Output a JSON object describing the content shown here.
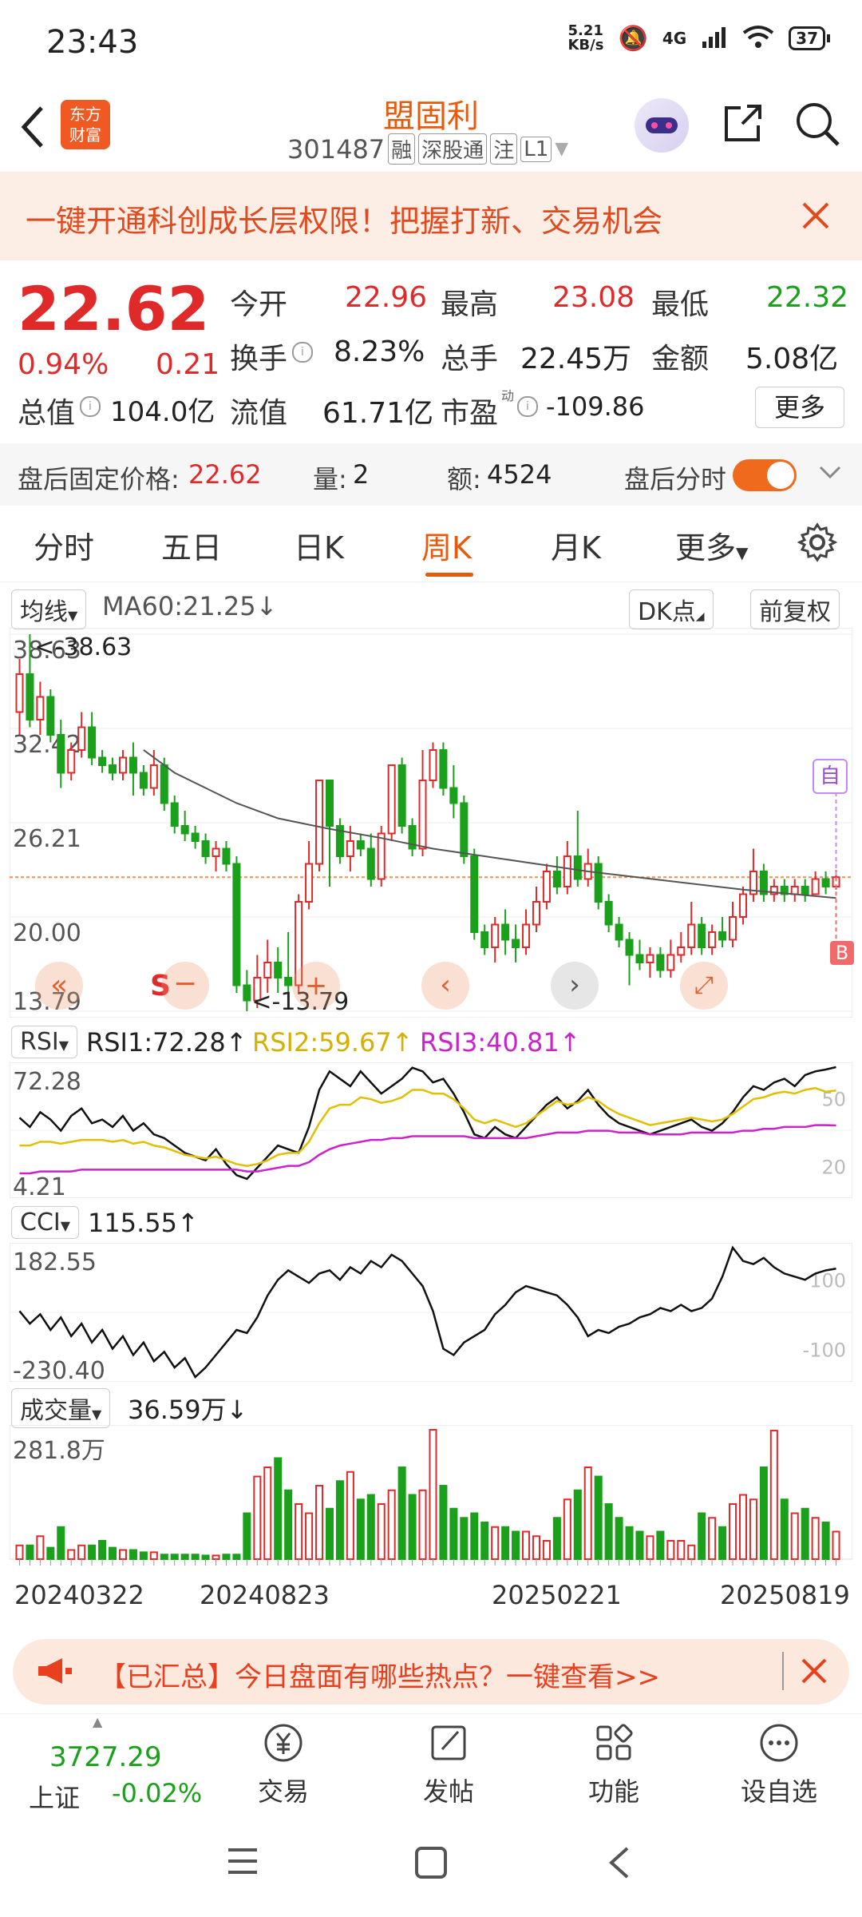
{
  "status": {
    "time": "23:43",
    "net_speed": "5.21",
    "net_unit": "KB/s",
    "network": "4G",
    "battery": "37"
  },
  "header": {
    "logo_line1": "东方",
    "logo_line2": "财富",
    "title": "盟固利",
    "code": "301487",
    "tags": [
      "融",
      "深股通",
      "注",
      "L1"
    ]
  },
  "banner": {
    "text": "一键开通科创成长层权限！把握打新、交易机会"
  },
  "quote": {
    "price": "22.62",
    "change_pct": "0.94%",
    "change": "0.21",
    "open_label": "今开",
    "open": "22.96",
    "high_label": "最高",
    "high": "23.08",
    "low_label": "最低",
    "low": "22.32",
    "turnover_label": "换手",
    "turnover": "8.23%",
    "volume_label": "总手",
    "volume": "22.45万",
    "amount_label": "金额",
    "amount": "5.08亿",
    "mktcap_label": "总值",
    "mktcap": "104.0亿",
    "float_label": "流值",
    "float": "61.71亿",
    "pe_label": "市盈",
    "pe_sup": "动",
    "pe": "-109.86",
    "more": "更多"
  },
  "afterhours": {
    "label": "盘后固定价格:",
    "price": "22.62",
    "vol_label": "量:",
    "vol": "2",
    "amt_label": "额:",
    "amt": "4524",
    "switch_label": "盘后分时"
  },
  "tabs": [
    "分时",
    "五日",
    "日K",
    "周K",
    "月K",
    "更多"
  ],
  "chart_controls": {
    "ma_select": "均线",
    "ma_text": "MA60:21.25",
    "dk": "DK点",
    "adjust": "前复权"
  },
  "chart_data": [
    {
      "type": "candlestick",
      "name": "周K",
      "y_labels": [
        "38.63",
        "32.42",
        "26.21",
        "20.00",
        "13.79"
      ],
      "ylim": [
        13.79,
        38.63
      ],
      "max_label": "<-38.63",
      "min_label": "<-13.79",
      "ref_price": 22.62,
      "x_labels": [
        "20240322",
        "20240823",
        "20250221",
        "20250819"
      ],
      "candles": [
        [
          33.5,
          36.0,
          32.0,
          37.0
        ],
        [
          36.0,
          33.0,
          32.5,
          38.63
        ],
        [
          33.0,
          34.5,
          32.0,
          35.5
        ],
        [
          34.5,
          32.0,
          31.5,
          35.0
        ],
        [
          32.0,
          29.5,
          28.5,
          33.0
        ],
        [
          29.5,
          31.0,
          29.0,
          31.5
        ],
        [
          31.0,
          32.5,
          30.5,
          33.5
        ],
        [
          32.5,
          30.5,
          30.0,
          33.5
        ],
        [
          30.5,
          30.0,
          29.5,
          31.0
        ],
        [
          30.0,
          29.5,
          29.0,
          30.5
        ],
        [
          29.5,
          30.5,
          29.0,
          31.0
        ],
        [
          30.5,
          29.5,
          28.0,
          31.5
        ],
        [
          29.5,
          28.5,
          28.0,
          30.0
        ],
        [
          28.5,
          30.0,
          28.0,
          31.0
        ],
        [
          30.0,
          27.5,
          27.0,
          30.5
        ],
        [
          27.5,
          26.0,
          25.5,
          28.0
        ],
        [
          26.0,
          25.5,
          25.0,
          27.0
        ],
        [
          25.5,
          25.0,
          24.5,
          26.0
        ],
        [
          25.0,
          24.0,
          23.5,
          25.5
        ],
        [
          24.0,
          24.5,
          23.0,
          25.0
        ],
        [
          24.5,
          23.5,
          23.0,
          25.0
        ],
        [
          23.5,
          15.5,
          15.0,
          24.0
        ],
        [
          15.5,
          14.5,
          13.79,
          16.5
        ],
        [
          14.5,
          16.0,
          14.0,
          17.5
        ],
        [
          16.0,
          17.0,
          15.0,
          18.5
        ],
        [
          17.0,
          16.0,
          15.0,
          18.0
        ],
        [
          16.0,
          15.5,
          15.0,
          19.0
        ],
        [
          15.5,
          21.0,
          15.0,
          21.5
        ],
        [
          21.0,
          23.5,
          20.5,
          25.0
        ],
        [
          23.5,
          29.0,
          23.0,
          29.0
        ],
        [
          29.0,
          26.0,
          22.0,
          27.0
        ],
        [
          26.0,
          24.0,
          23.5,
          26.5
        ],
        [
          24.0,
          25.0,
          23.0,
          26.0
        ],
        [
          25.0,
          24.5,
          24.0,
          25.5
        ],
        [
          24.5,
          22.5,
          22.0,
          25.5
        ],
        [
          22.5,
          25.5,
          22.0,
          26.0
        ],
        [
          25.5,
          30.0,
          25.0,
          30.0
        ],
        [
          30.0,
          26.0,
          25.5,
          30.5
        ],
        [
          26.0,
          24.5,
          24.0,
          26.5
        ],
        [
          24.5,
          29.0,
          24.0,
          31.0
        ],
        [
          29.0,
          31.0,
          28.5,
          31.5
        ],
        [
          31.0,
          28.5,
          28.0,
          31.5
        ],
        [
          28.5,
          27.5,
          26.5,
          30.0
        ],
        [
          27.5,
          24.0,
          23.5,
          28.0
        ],
        [
          24.0,
          19.0,
          18.5,
          24.5
        ],
        [
          19.0,
          18.0,
          17.5,
          19.5
        ],
        [
          18.0,
          19.5,
          17.0,
          20.0
        ],
        [
          19.5,
          18.5,
          17.5,
          20.5
        ],
        [
          18.5,
          18.0,
          17.0,
          19.5
        ],
        [
          18.0,
          19.5,
          17.5,
          20.5
        ],
        [
          19.5,
          21.0,
          19.0,
          22.0
        ],
        [
          21.0,
          23.0,
          20.5,
          23.5
        ],
        [
          23.0,
          22.0,
          21.5,
          24.0
        ],
        [
          22.0,
          24.0,
          21.5,
          25.0
        ],
        [
          24.0,
          22.5,
          22.0,
          27.0
        ],
        [
          22.5,
          23.5,
          22.0,
          24.5
        ],
        [
          23.5,
          21.0,
          20.5,
          24.0
        ],
        [
          21.0,
          19.5,
          19.0,
          21.5
        ],
        [
          19.5,
          18.5,
          18.0,
          20.0
        ],
        [
          18.5,
          17.5,
          15.5,
          19.0
        ],
        [
          17.5,
          17.0,
          16.5,
          18.5
        ],
        [
          17.0,
          17.5,
          16.0,
          18.0
        ],
        [
          17.5,
          16.5,
          16.0,
          18.0
        ],
        [
          16.5,
          17.5,
          16.0,
          18.5
        ],
        [
          17.5,
          18.0,
          17.0,
          19.0
        ],
        [
          18.0,
          19.5,
          17.5,
          21.0
        ],
        [
          19.5,
          18.0,
          17.5,
          20.0
        ],
        [
          18.0,
          19.0,
          17.5,
          19.5
        ],
        [
          19.0,
          18.5,
          18.0,
          20.0
        ],
        [
          18.5,
          20.0,
          18.0,
          21.0
        ],
        [
          20.0,
          21.5,
          19.5,
          22.0
        ],
        [
          21.5,
          23.0,
          21.0,
          24.5
        ],
        [
          23.0,
          21.5,
          21.0,
          23.5
        ],
        [
          21.5,
          22.0,
          21.0,
          22.5
        ],
        [
          22.0,
          21.5,
          21.0,
          22.5
        ],
        [
          21.5,
          22.0,
          21.0,
          22.5
        ],
        [
          22.0,
          21.5,
          21.0,
          22.5
        ],
        [
          21.5,
          22.5,
          21.5,
          23.0
        ],
        [
          22.5,
          22.0,
          21.5,
          23.0
        ],
        [
          22.0,
          22.62,
          21.8,
          23.08
        ]
      ],
      "ma60": [
        [
          12,
          31.0
        ],
        [
          15,
          29.5
        ],
        [
          18,
          28.5
        ],
        [
          21,
          27.5
        ],
        [
          25,
          26.5
        ],
        [
          30,
          25.8
        ],
        [
          35,
          25.2
        ],
        [
          40,
          24.5
        ],
        [
          45,
          24.0
        ],
        [
          50,
          23.5
        ],
        [
          55,
          23.0
        ],
        [
          60,
          22.6
        ],
        [
          65,
          22.2
        ],
        [
          70,
          21.8
        ],
        [
          75,
          21.5
        ],
        [
          79,
          21.25
        ]
      ]
    },
    {
      "type": "line",
      "name": "RSI",
      "ylim": [
        4.21,
        72.28
      ],
      "y_labels": [
        "72.28",
        "4.21"
      ],
      "right_labels": [
        "50",
        "20"
      ],
      "series": [
        {
          "name": "RSI1:72.28",
          "color": "#111111",
          "values": [
            45,
            40,
            48,
            44,
            38,
            46,
            50,
            42,
            44,
            40,
            46,
            38,
            42,
            36,
            34,
            30,
            26,
            24,
            22,
            28,
            20,
            14,
            12,
            18,
            24,
            30,
            28,
            26,
            40,
            60,
            70,
            66,
            62,
            70,
            64,
            58,
            62,
            66,
            72,
            70,
            64,
            66,
            58,
            48,
            36,
            34,
            40,
            36,
            34,
            40,
            46,
            52,
            56,
            50,
            54,
            60,
            52,
            46,
            42,
            40,
            38,
            36,
            38,
            40,
            42,
            44,
            40,
            38,
            42,
            48,
            56,
            62,
            60,
            64,
            66,
            62,
            68,
            70,
            71,
            72.28
          ]
        },
        {
          "name": "RSI2:59.67",
          "color": "#e0c000",
          "values": [
            30,
            30,
            32,
            32,
            31,
            32,
            33,
            33,
            33,
            32,
            33,
            31,
            32,
            30,
            29,
            27,
            25,
            24,
            23,
            24,
            22,
            20,
            19,
            20,
            22,
            25,
            26,
            26,
            32,
            42,
            50,
            52,
            52,
            56,
            55,
            53,
            54,
            56,
            60,
            60,
            58,
            58,
            55,
            50,
            44,
            42,
            44,
            42,
            40,
            42,
            46,
            50,
            54,
            52,
            53,
            56,
            54,
            50,
            47,
            45,
            43,
            41,
            42,
            43,
            44,
            45,
            44,
            43,
            44,
            47,
            51,
            55,
            56,
            58,
            59,
            58,
            60,
            61,
            59,
            59.67
          ]
        },
        {
          "name": "RSI3:40.81",
          "color": "#cc22cc",
          "values": [
            15,
            15,
            16,
            16,
            16,
            16,
            17,
            17,
            17,
            17,
            17,
            17,
            17,
            17,
            17,
            17,
            17,
            17,
            17,
            17,
            17,
            17,
            16,
            16,
            17,
            18,
            19,
            19,
            21,
            25,
            28,
            30,
            31,
            32,
            33,
            33,
            34,
            34,
            35,
            35,
            35,
            35,
            35,
            35,
            34,
            34,
            34,
            34,
            34,
            34,
            35,
            36,
            37,
            37,
            37,
            38,
            38,
            38,
            37,
            37,
            37,
            36,
            36,
            36,
            36,
            37,
            37,
            37,
            37,
            37,
            38,
            38,
            39,
            39,
            40,
            40,
            40,
            41,
            41,
            40.81
          ]
        }
      ]
    },
    {
      "type": "line",
      "name": "CCI",
      "ylim": [
        -230.4,
        182.55
      ],
      "y_labels": [
        "182.55",
        "-230.40"
      ],
      "right_labels": [
        "100",
        "-100"
      ],
      "series": [
        {
          "name": "CCI",
          "color": "#111111",
          "values": [
            -20,
            -60,
            -30,
            -80,
            -40,
            -100,
            -60,
            -120,
            -80,
            -140,
            -100,
            -160,
            -120,
            -180,
            -150,
            -200,
            -170,
            -230.4,
            -200,
            -160,
            -120,
            -80,
            -90,
            -40,
            30,
            80,
            110,
            90,
            70,
            100,
            110,
            80,
            120,
            100,
            140,
            120,
            160,
            140,
            100,
            60,
            -20,
            -140,
            -160,
            -120,
            -100,
            -80,
            -30,
            0,
            40,
            60,
            50,
            40,
            30,
            0,
            -40,
            -100,
            -80,
            -90,
            -70,
            -60,
            -40,
            -30,
            -10,
            -20,
            0,
            -20,
            -10,
            20,
            90,
            182.55,
            140,
            130,
            150,
            120,
            100,
            90,
            80,
            100,
            110,
            115.55
          ]
        }
      ]
    },
    {
      "type": "bar",
      "name": "成交量",
      "ylim": [
        0,
        281.8
      ],
      "y_labels": [
        "281.8万"
      ],
      "legend": "36.59万",
      "values": [
        30,
        30,
        50,
        25,
        70,
        20,
        30,
        30,
        40,
        25,
        20,
        20,
        15,
        15,
        10,
        10,
        10,
        10,
        8,
        8,
        10,
        10,
        100,
        180,
        200,
        220,
        150,
        120,
        100,
        160,
        110,
        170,
        190,
        130,
        140,
        120,
        150,
        200,
        140,
        150,
        281.8,
        160,
        110,
        90,
        100,
        80,
        70,
        70,
        60,
        60,
        50,
        40,
        90,
        130,
        150,
        200,
        180,
        120,
        90,
        70,
        60,
        50,
        60,
        40,
        40,
        30,
        100,
        90,
        70,
        120,
        140,
        130,
        200,
        280,
        130,
        100,
        110,
        90,
        80,
        60
      ]
    }
  ],
  "chart_overlay": {
    "marker_self": "自",
    "marker_b": "B",
    "marker_s": "S"
  },
  "adbar": {
    "text": "【已汇总】今日盘面有哪些热点？一键查看>>"
  },
  "bottom": {
    "index_value": "3727.29",
    "index_name": "上证",
    "index_change": "-0.02%",
    "nav": [
      "交易",
      "发帖",
      "功能",
      "设自选"
    ]
  }
}
